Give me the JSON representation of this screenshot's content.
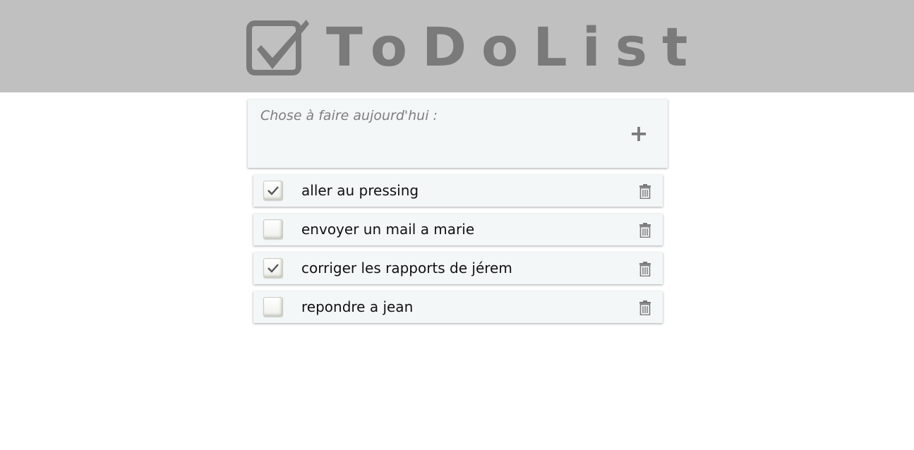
{
  "header": {
    "title": "ToDoList",
    "logo_icon": "checkbox-checked-icon",
    "background_color": "#c0c0c0",
    "logo_color": "#7a7a7a"
  },
  "new_task": {
    "placeholder": "Chose à faire aujourd'hui :",
    "value": "",
    "add_icon": "plus-icon"
  },
  "tasks": [
    {
      "label": "aller au pressing",
      "done": true
    },
    {
      "label": "envoyer un mail a marie",
      "done": false
    },
    {
      "label": "corriger les rapports de jérem",
      "done": true
    },
    {
      "label": "repondre a jean",
      "done": false
    }
  ],
  "icons": {
    "delete": "trash-icon",
    "check": "checkmark-icon"
  }
}
